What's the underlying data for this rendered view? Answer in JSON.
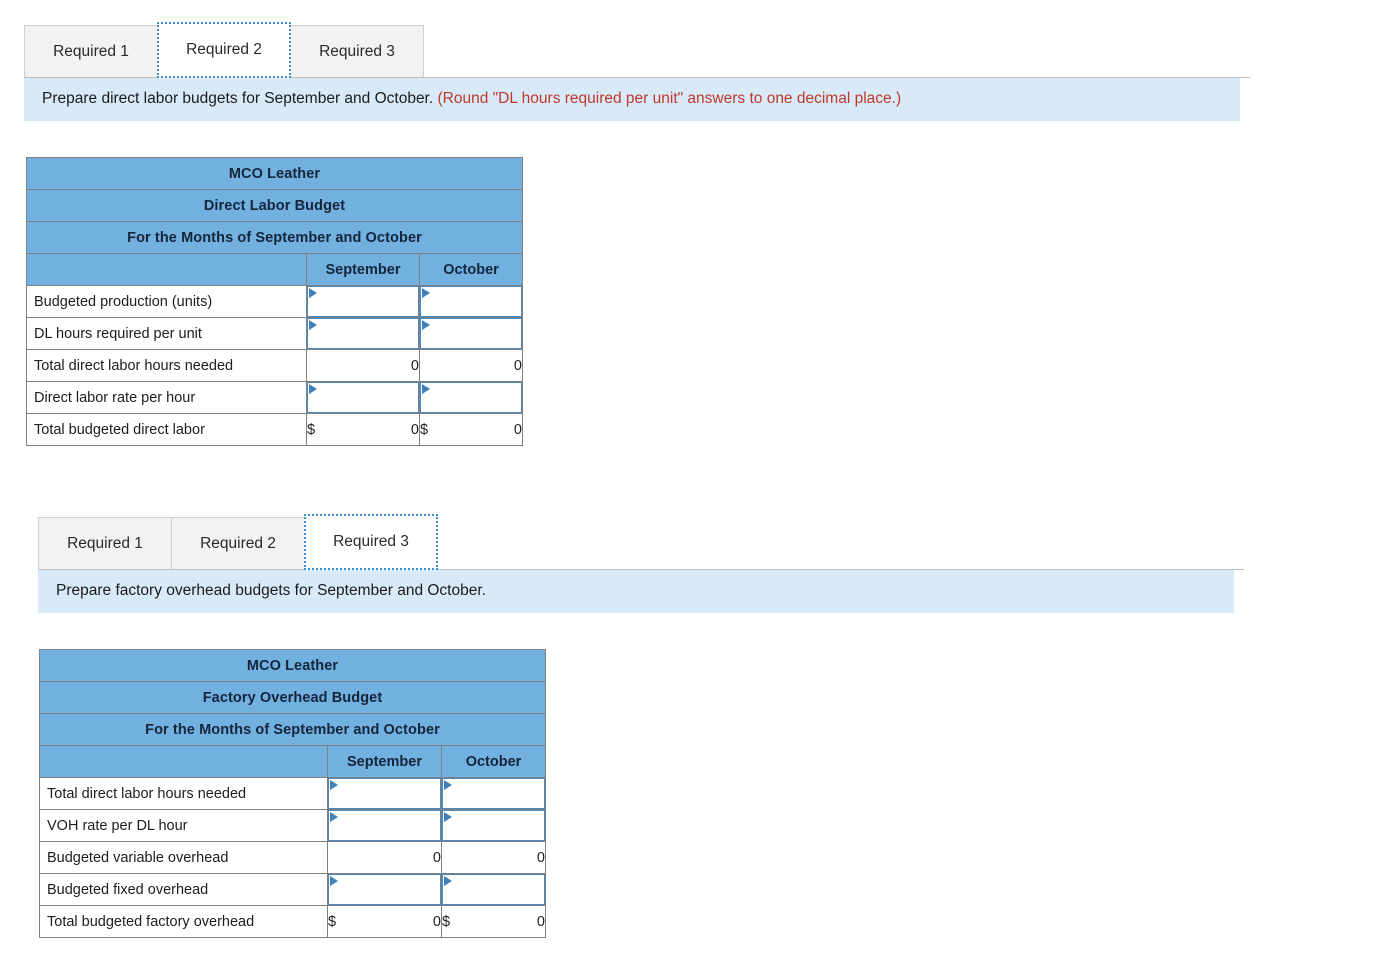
{
  "sections": [
    {
      "id": "required-2",
      "tabs": [
        {
          "label": "Required 1",
          "active": false
        },
        {
          "label": "Required 2",
          "active": true
        },
        {
          "label": "Required 3",
          "active": false
        }
      ],
      "instruction": {
        "text": "Prepare direct labor budgets for September and October.",
        "note": "(Round \"DL hours required per unit\" answers to one decimal place.)"
      },
      "table": {
        "title_lines": [
          "MCO Leather",
          "Direct Labor Budget",
          "For the Months of September and October"
        ],
        "columns": [
          "September",
          "October"
        ],
        "rows": [
          {
            "label": "Budgeted production (units)",
            "type": "entry",
            "values": [
              "",
              ""
            ]
          },
          {
            "label": "DL hours required per unit",
            "type": "entry",
            "values": [
              "",
              ""
            ]
          },
          {
            "label": "Total direct labor hours needed",
            "type": "calc",
            "values": [
              "0",
              "0"
            ]
          },
          {
            "label": "Direct labor rate per hour",
            "type": "entry",
            "values": [
              "",
              ""
            ]
          },
          {
            "label": "Total budgeted direct labor",
            "type": "total",
            "currency": "$",
            "values": [
              "0",
              "0"
            ]
          }
        ]
      }
    },
    {
      "id": "required-3",
      "tabs": [
        {
          "label": "Required 1",
          "active": false
        },
        {
          "label": "Required 2",
          "active": false
        },
        {
          "label": "Required 3",
          "active": true
        }
      ],
      "instruction": {
        "text": "Prepare factory overhead budgets for September and October.",
        "note": ""
      },
      "table": {
        "title_lines": [
          "MCO Leather",
          "Factory Overhead Budget",
          "For the Months of September and October"
        ],
        "columns": [
          "September",
          "October"
        ],
        "rows": [
          {
            "label": "Total direct labor hours needed",
            "type": "entry",
            "values": [
              "",
              ""
            ]
          },
          {
            "label": "VOH rate per DL hour",
            "type": "entry",
            "values": [
              "",
              ""
            ]
          },
          {
            "label": "Budgeted variable overhead",
            "type": "calc",
            "values": [
              "0",
              "0"
            ]
          },
          {
            "label": "Budgeted fixed overhead",
            "type": "entry",
            "values": [
              "",
              ""
            ]
          },
          {
            "label": "Total budgeted factory overhead",
            "type": "total",
            "currency": "$",
            "values": [
              "0",
              "0"
            ]
          }
        ]
      }
    }
  ],
  "colors": {
    "header_blue": "#71b0df",
    "instruction_blue": "#d8e9f7",
    "note_red": "#c0392b",
    "focus_blue": "#3f8fd0",
    "entry_border": "#4a88bd"
  }
}
